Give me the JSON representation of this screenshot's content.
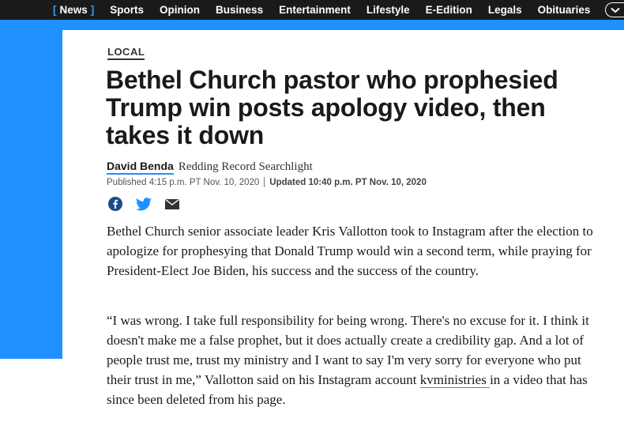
{
  "nav": {
    "items": [
      {
        "label": "News",
        "active": true
      },
      {
        "label": "Sports"
      },
      {
        "label": "Opinion"
      },
      {
        "label": "Business"
      },
      {
        "label": "Entertainment"
      },
      {
        "label": "Lifestyle"
      },
      {
        "label": "E-Edition"
      },
      {
        "label": "Legals"
      },
      {
        "label": "Obituaries"
      }
    ],
    "bracket_open": "[",
    "bracket_close": "]"
  },
  "colors": {
    "accent": "#1e90ff",
    "nav_bg": "#1a1a1a"
  },
  "article": {
    "section": "LOCAL",
    "headline": "Bethel Church pastor who prophesied Trump win posts apology video, then takes it down",
    "author": "David Benda",
    "source": "Redding Record Searchlight",
    "published": "Published 4:15 p.m. PT Nov. 10, 2020",
    "updated": "Updated 10:40 p.m. PT Nov. 10, 2020",
    "share_icons": [
      "facebook-icon",
      "twitter-icon",
      "email-icon"
    ],
    "paragraph1": "Bethel Church senior associate leader Kris Vallotton took to Instagram after the election to apologize for prophesying that Donald Trump would win a second term, while praying for President-Elect Joe Biden, his success and the success of the country.",
    "paragraph2_before": "“I was wrong. I take full responsibility for being wrong. There's no excuse for it. I think it doesn't make me a false prophet, but it does actually create a credibility gap. And a lot of people trust me, trust my ministry and I want to say I'm very sorry for everyone who put their trust in me,” Vallotton said on his Instagram account ",
    "paragraph2_link": "kvministries ",
    "paragraph2_after": "in a video that has since been deleted from his page."
  }
}
